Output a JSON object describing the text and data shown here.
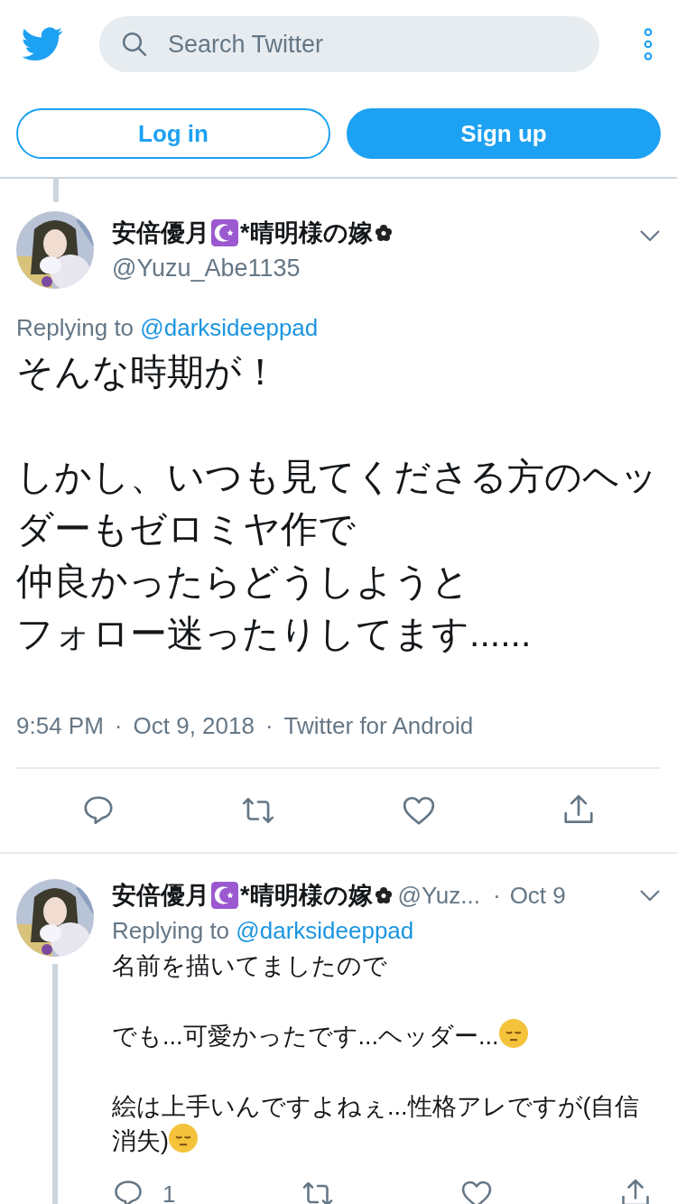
{
  "search": {
    "placeholder": "Search Twitter"
  },
  "auth_buttons": [
    {
      "label": "Log in",
      "kind": "outline"
    },
    {
      "label": "Sign up",
      "kind": "filled"
    }
  ],
  "main_tweet": {
    "name": "安倍優月",
    "name_suffix": "*晴明様の嫁",
    "handle": "@Yuzu_Abe1135",
    "replying_label": "Replying to",
    "replying_to": "@darksideeppad",
    "paragraphs": [
      [
        "そんな時期が！"
      ],
      [
        "しかし、いつも見てくださる方のヘッダーもゼロミヤ作で",
        "仲良かったらどうしようと",
        "フォロー迷ったりしてます......"
      ]
    ],
    "meta": [
      "9:54 PM",
      "Oct 9, 2018",
      "Twitter for Android"
    ],
    "meta_separator": "·"
  },
  "reply_tweet": {
    "name": "安倍優月",
    "name_suffix": "*晴明様の嫁",
    "handle": "@Yuz...",
    "separator": "·",
    "date": "Oct 9",
    "replying_label": "Replying to",
    "replying_to": "@darksideeppad",
    "paragraphs": [
      {
        "text": "名前を描いてましたので",
        "emoji": false
      },
      {
        "text": "でも...可愛かったです...ヘッダー...",
        "emoji": true
      },
      {
        "text": "絵は上手いんですよねぇ...性格アレですが(自信消失)",
        "emoji": true
      }
    ],
    "reply_count": "1"
  }
}
